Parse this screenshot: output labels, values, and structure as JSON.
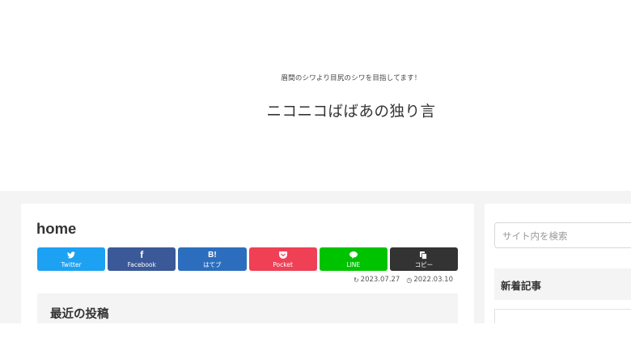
{
  "header": {
    "tagline": "眉間のシワより目尻のシワを目指してます！",
    "site_title": "ニコニコばばあの独り言"
  },
  "article": {
    "title": "home",
    "share_buttons": [
      {
        "icon": "twitter-icon",
        "icon_glyph": "🐦",
        "label": "Twitter",
        "color": "#1da1f2"
      },
      {
        "icon": "facebook-icon",
        "icon_glyph": "f",
        "label": "Facebook",
        "color": "#3b5998"
      },
      {
        "icon": "hatebu-icon",
        "icon_glyph": "B!",
        "label": "はてブ",
        "color": "#2c6ebd"
      },
      {
        "icon": "pocket-icon",
        "icon_glyph": "❯",
        "label": "Pocket",
        "color": "#ef4056"
      },
      {
        "icon": "line-icon",
        "icon_glyph": "💬",
        "label": "LINE",
        "color": "#00c300"
      },
      {
        "icon": "copy-icon",
        "icon_glyph": "▤",
        "label": "コピー",
        "color": "#333333"
      }
    ],
    "updated_date": "2023.07.27",
    "published_date": "2022.03.10",
    "widget_title": "最近の投稿"
  },
  "sidebar": {
    "search_placeholder": "サイト内を検索",
    "new_posts_heading": "新着記事"
  }
}
